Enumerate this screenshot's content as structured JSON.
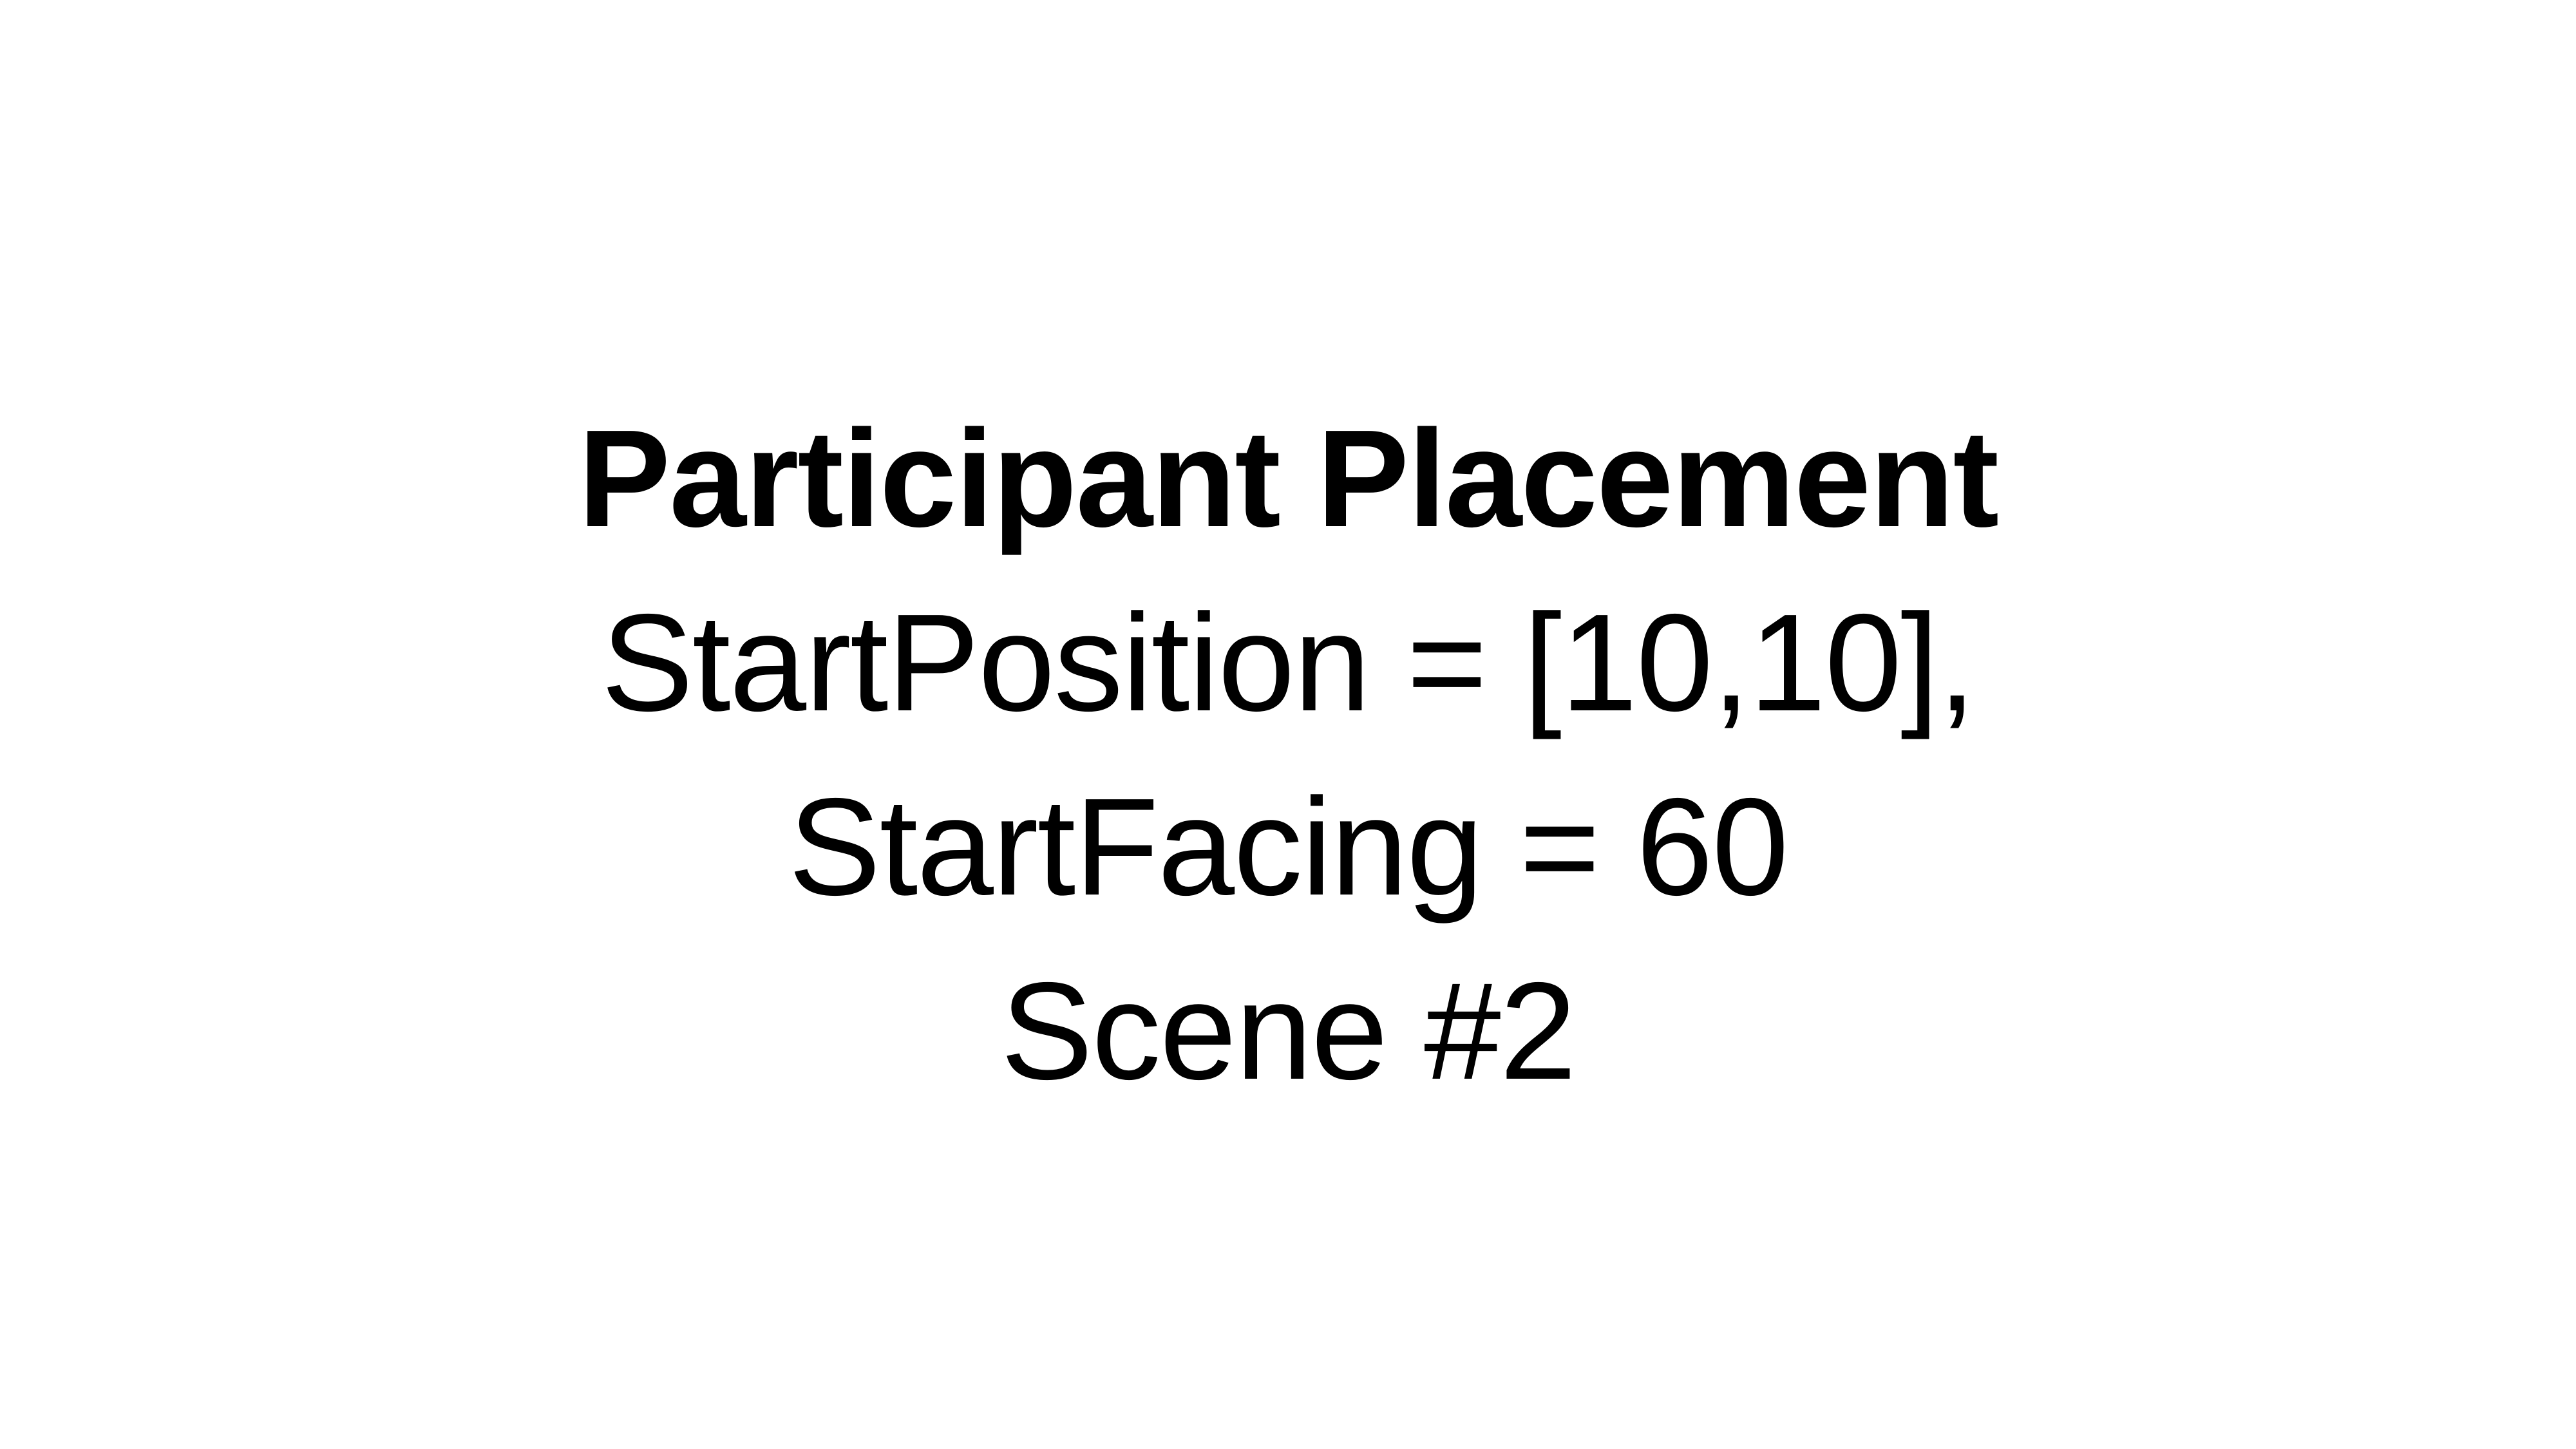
{
  "slide": {
    "title": "Participant Placement",
    "lines": [
      "StartPosition = [10,10],",
      "StartFacing = 60",
      "Scene #2"
    ]
  },
  "colors": {
    "background": "#ffffff",
    "text": "#000000"
  }
}
